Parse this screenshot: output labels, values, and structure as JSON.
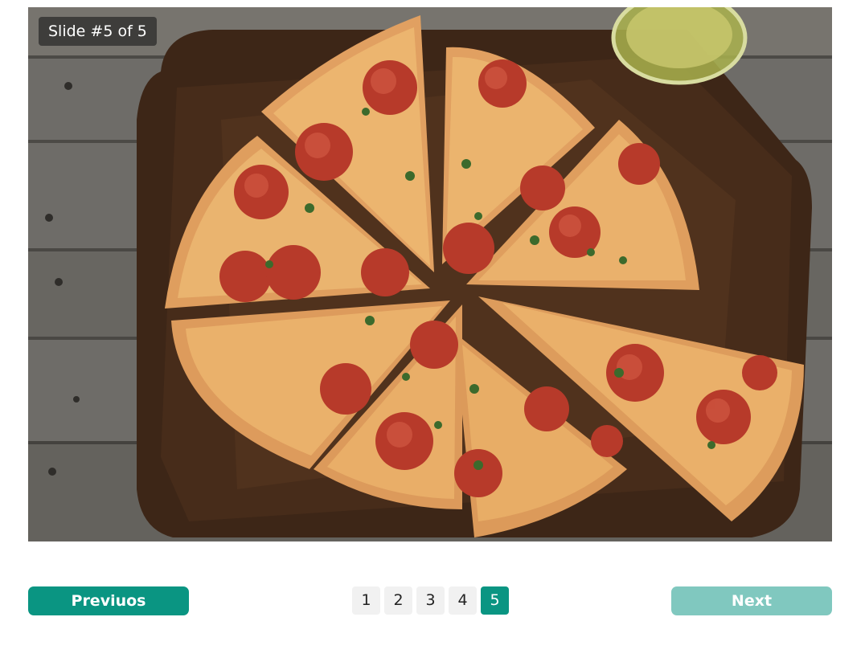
{
  "slideshow": {
    "counter": "Slide #5 of 5",
    "image": {
      "subject": "pepperoni-pizza-photo"
    },
    "prev_label": "Previuos",
    "next_label": "Next",
    "pages": [
      "1",
      "2",
      "3",
      "4",
      "5"
    ],
    "current_page": "5"
  },
  "colors": {
    "accent": "#0a9582",
    "accent_disabled": "#80c8bf",
    "page_bg": "#f1f1f1"
  }
}
